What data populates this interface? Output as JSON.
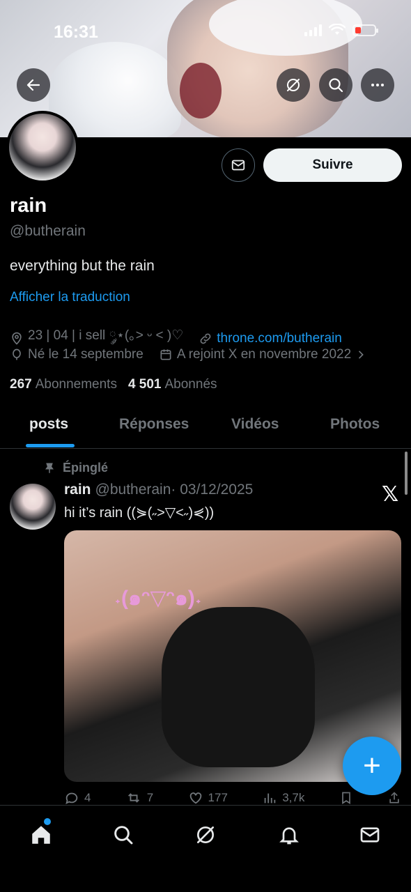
{
  "status_bar": {
    "time": "16:31"
  },
  "profile": {
    "name": "rain",
    "handle": "@butherain",
    "bio": "everything but the rain",
    "translate_label": "Afficher la traduction",
    "location": "23 | 04 | i sell ༘⋆(｡˃ ᵕ ˂ )♡",
    "website": "throne.com/butherain",
    "birthday": "Né le 14 septembre",
    "joined": "A rejoint X en novembre 2022",
    "following_count": "267",
    "following_label": "Abonnements",
    "followers_count": "4 501",
    "followers_label": "Abonnés",
    "follow_button": "Suivre"
  },
  "tabs": [
    {
      "label": "posts",
      "active": true
    },
    {
      "label": "Réponses",
      "active": false
    },
    {
      "label": "Vidéos",
      "active": false
    },
    {
      "label": "Photos",
      "active": false
    }
  ],
  "pinned_post": {
    "pinned_label": "Épinglé",
    "author_name": "rain",
    "author_handle": "@butherain",
    "date": "· 03/12/2025",
    "text": "hi it’s rain ((⋟(˶>▽<˶)⋞))",
    "media_sticker": "˖(๑ᵔ▽ᵔ๑)˖",
    "counts": {
      "replies": "4",
      "reposts": "7",
      "likes": "177",
      "views": "3,7k"
    }
  },
  "colors": {
    "accent": "#1d9bf0",
    "background": "#000000",
    "text_primary": "#e7e9ea",
    "text_secondary": "#71767b"
  },
  "icons": {
    "back": "arrow-left-icon",
    "grok": "slash-circle-icon",
    "search": "search-icon",
    "more": "more-icon",
    "mail": "mail-icon",
    "pin": "pin-icon",
    "x_logo": "x-logo-icon",
    "fab": "plus-icon",
    "nav": [
      "home-icon",
      "search-icon",
      "grok-icon",
      "bell-icon",
      "mail-icon"
    ]
  }
}
